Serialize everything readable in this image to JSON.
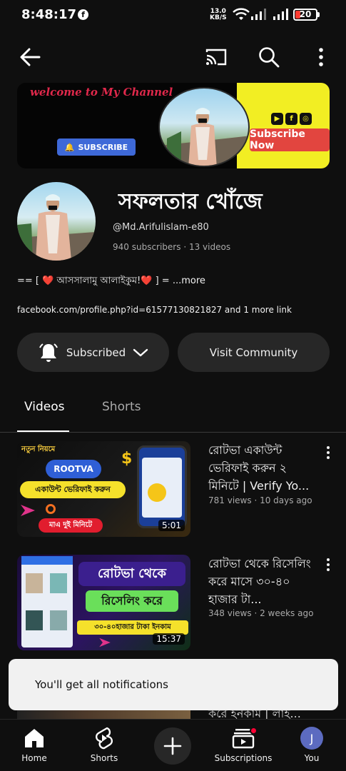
{
  "status_bar": {
    "time": "8:48:17",
    "notification_app": "f",
    "net_speed_value": "13.0",
    "net_speed_unit": "KB/S",
    "battery_level": "20"
  },
  "banner": {
    "welcome_text": "welcome to My Channel",
    "subscribe_button": "SUBSCRIBE",
    "subscribe_now": "Subscribe Now"
  },
  "channel": {
    "name": "সফলতার খোঁজে",
    "handle": "@Md.Arifulislam-e80",
    "subscribers": "940 subscribers",
    "videos_count": "13 videos",
    "description": "== [ ❤️ আসসালামু আলাইকুম!❤️ ] = ",
    "more_label": "...more",
    "link_text": "facebook.com/profile.php?id=61577130821827 and 1 more link"
  },
  "actions": {
    "subscribed_label": "Subscribed",
    "visit_community_label": "Visit Community"
  },
  "tabs": [
    {
      "label": "Videos",
      "active": true
    },
    {
      "label": "Shorts",
      "active": false
    }
  ],
  "videos": [
    {
      "title": "রোটভা একাউন্ট ভেরিফাই করুন ২ মিনিটে | Verify Yo...",
      "views": "781 views",
      "age": "10 days ago",
      "duration": "5:01",
      "thumb_top_label": "নতুন নিয়মে",
      "thumb_brand": "ROOTVA",
      "thumb_caption": "একাউন্ট ভেরিফাই করুন",
      "thumb_footer": "মাএ দুই মিনিটে"
    },
    {
      "title": "রোটভা থেকে রিসেলিং করে মাসে ৩০-৪০ হাজার টা...",
      "views": "348 views",
      "age": "2 weeks ago",
      "duration": "15:37",
      "thumb_line1": "রোটভা থেকে",
      "thumb_line2": "রিসেলিং করে",
      "thumb_line3": "৩০-৪০হাজার টাকা ইনকাম"
    }
  ],
  "peek_title": "করে ইনকাম | লাই...",
  "toast": {
    "message": "You'll get all notifications"
  },
  "bottom_nav": {
    "home": "Home",
    "shorts": "Shorts",
    "subscriptions": "Subscriptions",
    "you": "You",
    "you_initial": "J"
  },
  "colors": {
    "background": "#0f0f0f",
    "pill": "#272727",
    "badge_red": "#ff0033",
    "avatar": "#5c6bc0"
  },
  "icons": [
    "back-arrow-icon",
    "cast-icon",
    "search-icon",
    "more-vert-icon",
    "bell-icon",
    "chevron-down-icon",
    "home-icon",
    "shorts-icon",
    "plus-icon",
    "subscriptions-icon"
  ]
}
